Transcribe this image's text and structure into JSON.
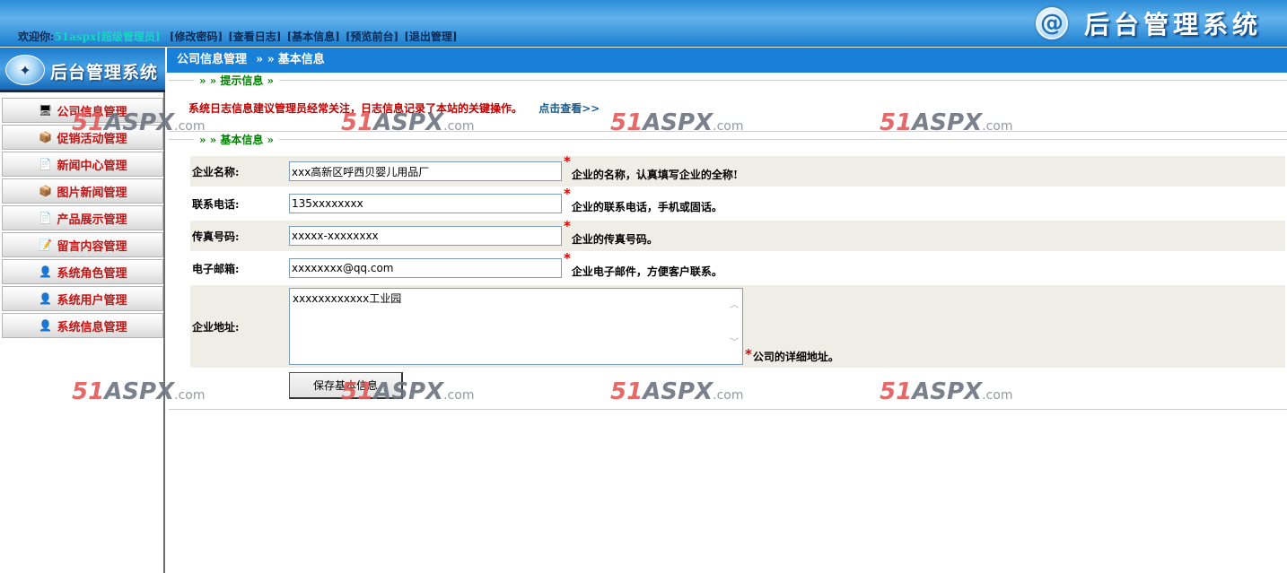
{
  "header": {
    "welcome": "欢迎你:",
    "user": "51aspx[超级管理员]",
    "links": [
      "[修改密码]",
      "[查看日志]",
      "[基本信息]",
      "[预览前台]",
      "[退出管理]"
    ],
    "brand_icon": "@",
    "brand_title": "后台管理系统"
  },
  "sidebar": {
    "logo_text": "后台管理系统",
    "items": [
      {
        "label": "公司信息管理",
        "icon": "computer-icon"
      },
      {
        "label": "促销活动管理",
        "icon": "gift-box-icon"
      },
      {
        "label": "新闻中心管理",
        "icon": "document-icon"
      },
      {
        "label": "图片新闻管理",
        "icon": "gift-box-icon"
      },
      {
        "label": "产品展示管理",
        "icon": "document-icon"
      },
      {
        "label": "留言内容管理",
        "icon": "note-edit-icon"
      },
      {
        "label": "系统角色管理",
        "icon": "user-icon"
      },
      {
        "label": "系统用户管理",
        "icon": "user-icon"
      },
      {
        "label": "系统信息管理",
        "icon": "user-icon"
      }
    ]
  },
  "breadcrumb": {
    "parent": "公司信息管理",
    "separator": "» »",
    "current": "基本信息"
  },
  "tips": {
    "legend": "» » 提示信息 »",
    "text": "系统日志信息建议管理员经常关注，日志信息记录了本站的关键操作。",
    "link": "点击查看>>"
  },
  "basic_info": {
    "legend": "» » 基本信息 »",
    "fields": {
      "name": {
        "label": "企业名称:",
        "value": "xxx高新区呼西贝婴儿用品厂",
        "hint": "企业的名称，认真填写企业的全称!"
      },
      "phone": {
        "label": "联系电话:",
        "value": "135xxxxxxxx",
        "hint": "企业的联系电话，手机或固话。"
      },
      "fax": {
        "label": "传真号码:",
        "value": "xxxxx-xxxxxxxx",
        "hint": "企业的传真号码。"
      },
      "email": {
        "label": "电子邮箱:",
        "value": "xxxxxxxx@qq.com",
        "hint": "企业电子邮件，方便客户联系。"
      },
      "address": {
        "label": "企业地址:",
        "value": "xxxxxxxxxxxx工业园",
        "hint": "公司的详细地址。"
      }
    },
    "required_mark": "*",
    "save_label": "保存基本信息"
  },
  "watermark": {
    "num": "51",
    "asp": "ASPX",
    "com": ".com"
  },
  "colors": {
    "header_blue": "#1880d8",
    "menu_red": "#c41414",
    "legend_green": "#008000",
    "tip_red": "#c40000",
    "row_bg": "#efeee6"
  }
}
